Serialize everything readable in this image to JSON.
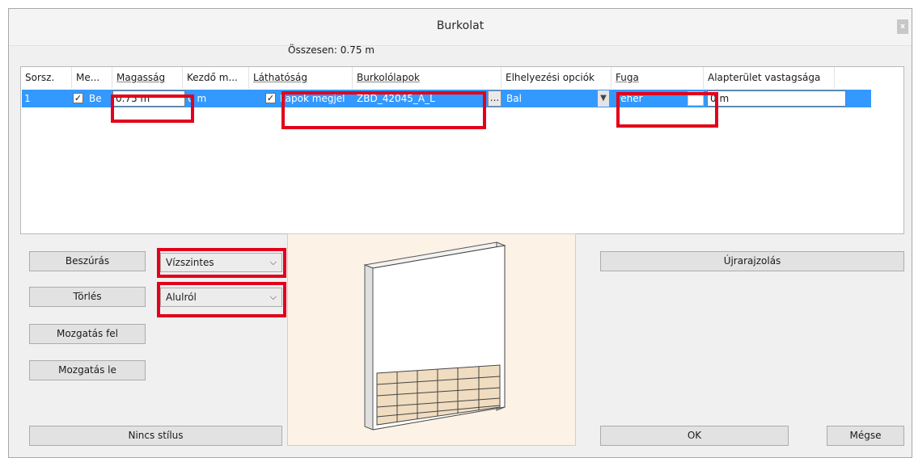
{
  "window": {
    "title": "Burkolat",
    "close_label": "x"
  },
  "summary": {
    "total": "Összesen: 0.75 m"
  },
  "table": {
    "columns": [
      "Sorsz.",
      "Me...",
      "Magasság",
      "Kezdő m...",
      "Láthatóság",
      "Burkolólapok",
      "Elhelyezési opciók",
      "Fuga",
      "Alapterület vastagsága"
    ],
    "row": {
      "index": "1",
      "me_text": "Be",
      "height": "0.75 m",
      "start": "0 m",
      "visibility": "Lapok megjel",
      "tiles": "ZBD_42045_A_L",
      "tiles_button": "...",
      "placement": "Bal",
      "fuga": "Fehér",
      "floor_thickness": "0 m"
    }
  },
  "buttons": {
    "insert": "Beszúrás",
    "delete": "Törlés",
    "move_up": "Mozgatás fel",
    "move_down": "Mozgatás le",
    "no_style": "Nincs stílus",
    "redraw": "Újrarajzolás",
    "ok": "OK",
    "cancel": "Mégse"
  },
  "selects": {
    "direction": "Vízszintes",
    "origin": "Alulról"
  },
  "colors": {
    "selection": "#3399ff",
    "highlight": "#e3001b",
    "preview_bg": "#fcf2e6"
  }
}
